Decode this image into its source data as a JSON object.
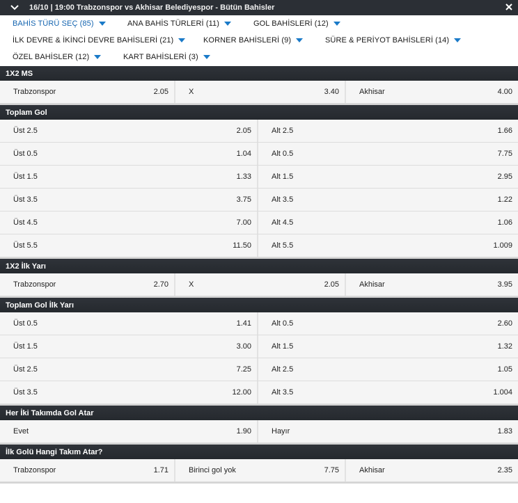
{
  "header": {
    "title": "16/10 | 19:00 Trabzonspor vs Akhisar Belediyespor - Bütün Bahisler"
  },
  "filters": [
    {
      "label": "BAHİS TÜRÜ SEÇ (85)",
      "active": true
    },
    {
      "label": "ANA BAHİS TÜRLERİ (11)",
      "active": false
    },
    {
      "label": "GOL BAHİSLERİ (12)",
      "active": false
    },
    {
      "label": "İLK DEVRE & İKİNCİ DEVRE BAHİSLERİ (21)",
      "active": false
    },
    {
      "label": "KORNER BAHİSLERİ (9)",
      "active": false
    },
    {
      "label": "SÜRE & PERİYOT BAHİSLERİ (14)",
      "active": false
    },
    {
      "label": "ÖZEL BAHİSLER (12)",
      "active": false
    },
    {
      "label": "KART BAHİSLERİ (3)",
      "active": false
    }
  ],
  "sections": [
    {
      "title": "1X2 MS",
      "rows": [
        [
          {
            "label": "Trabzonspor",
            "odd": "2.05"
          },
          {
            "label": "X",
            "odd": "3.40"
          },
          {
            "label": "Akhisar",
            "odd": "4.00"
          }
        ]
      ]
    },
    {
      "title": "Toplam Gol",
      "rows": [
        [
          {
            "label": "Üst 2.5",
            "odd": "2.05"
          },
          {
            "label": "Alt 2.5",
            "odd": "1.66"
          }
        ],
        [
          {
            "label": "Üst 0.5",
            "odd": "1.04"
          },
          {
            "label": "Alt 0.5",
            "odd": "7.75"
          }
        ],
        [
          {
            "label": "Üst 1.5",
            "odd": "1.33"
          },
          {
            "label": "Alt 1.5",
            "odd": "2.95"
          }
        ],
        [
          {
            "label": "Üst 3.5",
            "odd": "3.75"
          },
          {
            "label": "Alt 3.5",
            "odd": "1.22"
          }
        ],
        [
          {
            "label": "Üst 4.5",
            "odd": "7.00"
          },
          {
            "label": "Alt 4.5",
            "odd": "1.06"
          }
        ],
        [
          {
            "label": "Üst 5.5",
            "odd": "11.50"
          },
          {
            "label": "Alt 5.5",
            "odd": "1.009"
          }
        ]
      ]
    },
    {
      "title": "1X2 İlk Yarı",
      "rows": [
        [
          {
            "label": "Trabzonspor",
            "odd": "2.70"
          },
          {
            "label": "X",
            "odd": "2.05"
          },
          {
            "label": "Akhisar",
            "odd": "3.95"
          }
        ]
      ]
    },
    {
      "title": "Toplam Gol İlk Yarı",
      "rows": [
        [
          {
            "label": "Üst 0.5",
            "odd": "1.41"
          },
          {
            "label": "Alt 0.5",
            "odd": "2.60"
          }
        ],
        [
          {
            "label": "Üst 1.5",
            "odd": "3.00"
          },
          {
            "label": "Alt 1.5",
            "odd": "1.32"
          }
        ],
        [
          {
            "label": "Üst 2.5",
            "odd": "7.25"
          },
          {
            "label": "Alt 2.5",
            "odd": "1.05"
          }
        ],
        [
          {
            "label": "Üst 3.5",
            "odd": "12.00"
          },
          {
            "label": "Alt 3.5",
            "odd": "1.004"
          }
        ]
      ]
    },
    {
      "title": "Her İki Takımda Gol Atar",
      "rows": [
        [
          {
            "label": "Evet",
            "odd": "1.90"
          },
          {
            "label": "Hayır",
            "odd": "1.83"
          }
        ]
      ]
    },
    {
      "title": "İlk Golü Hangi Takım Atar?",
      "rows": [
        [
          {
            "label": "Trabzonspor",
            "odd": "1.71"
          },
          {
            "label": "Birinci gol yok",
            "odd": "7.75"
          },
          {
            "label": "Akhisar",
            "odd": "2.35"
          }
        ]
      ]
    }
  ],
  "colors": {
    "header_bg": "#2b2f35",
    "accent": "#1a7ac8",
    "active_filter": "#1565b0",
    "row_bg": "#f5f5f5"
  },
  "icons": {
    "collapse": "chevron-down-icon",
    "close": "close-icon",
    "dropdown": "triangle-down-icon"
  }
}
